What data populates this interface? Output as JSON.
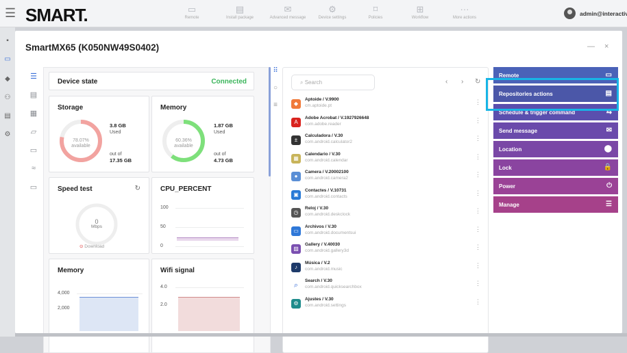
{
  "header": {
    "logo": "SMART.",
    "nav": [
      {
        "label": "Remote",
        "icon": "monitor-icon"
      },
      {
        "label": "Install package",
        "icon": "package-icon"
      },
      {
        "label": "Advanced message",
        "icon": "message-icon"
      },
      {
        "label": "Device settings",
        "icon": "gear-icon"
      },
      {
        "label": "Policies",
        "icon": "bookmark-icon"
      },
      {
        "label": "Workflow",
        "icon": "workflow-icon"
      },
      {
        "label": "More actions",
        "icon": "more-icon"
      }
    ],
    "user": "admin@interactiv"
  },
  "modal": {
    "title": "SmartMX65 (K050NW49S0402)",
    "device_state": {
      "label": "Device state",
      "status": "Connected"
    },
    "storage": {
      "title": "Storage",
      "used": "3.8 GB",
      "used_label": "Used",
      "available_pct": "78.07%",
      "available_label": "available",
      "out_of_label": "out of",
      "total": "17.35 GB",
      "available_fraction": 0.7807
    },
    "memory": {
      "title": "Memory",
      "used": "1.87 GB",
      "used_label": "Used",
      "available_pct": "60.36%",
      "available_label": "available",
      "out_of_label": "out of",
      "total": "4.73 GB",
      "available_fraction": 0.6036
    },
    "speed_test": {
      "title": "Speed test",
      "value": "0",
      "unit": "Mbps",
      "download": "Download"
    },
    "cpu": {
      "title": "CPU_PERCENT",
      "ticks": [
        "100",
        "50",
        "0"
      ]
    },
    "memory_chart": {
      "title": "Memory",
      "ticks": [
        "4,000",
        "2,000"
      ]
    },
    "wifi": {
      "title": "Wifi signal",
      "ticks": [
        "4.0",
        "2.0"
      ]
    },
    "apps": {
      "search_placeholder": "Search",
      "items": [
        {
          "name": "Aptoide / V.9900",
          "pkg": "cm.aptoide.pt",
          "color": "#f07a3a",
          "glyph": "◆"
        },
        {
          "name": "Adobe Acrobat / V.1927926648",
          "pkg": "com.adobe.reader",
          "color": "#d9231e",
          "glyph": "A"
        },
        {
          "name": "Calculadora / V.30",
          "pkg": "com.android.calculator2",
          "color": "#333333",
          "glyph": "±"
        },
        {
          "name": "Calendario / V.30",
          "pkg": "com.android.calendar",
          "color": "#c8b45a",
          "glyph": "▦"
        },
        {
          "name": "Camera / V.20002100",
          "pkg": "com.android.camera2",
          "color": "#5a8fd6",
          "glyph": "●"
        },
        {
          "name": "Contactes / V.10731",
          "pkg": "com.android.contacts",
          "color": "#2a7ad6",
          "glyph": "▣"
        },
        {
          "name": "Reloj / V.30",
          "pkg": "com.android.deskclock",
          "color": "#555555",
          "glyph": "◷"
        },
        {
          "name": "Archivos / V.30",
          "pkg": "com.android.documentsui",
          "color": "#2f78d8",
          "glyph": "▭"
        },
        {
          "name": "Gallery / V.40030",
          "pkg": "com.android.gallery3d",
          "color": "#7a4fb0",
          "glyph": "▨"
        },
        {
          "name": "Música / V.2",
          "pkg": "com.android.music",
          "color": "#1e3a6a",
          "glyph": "♪"
        },
        {
          "name": "Search / V.30",
          "pkg": "com.android.quicksearchbox",
          "color": "#ffffff",
          "glyph": "⌕"
        },
        {
          "name": "Ajustes / V.30",
          "pkg": "com.android.settings",
          "color": "#1f8c8c",
          "glyph": "⚙"
        }
      ]
    },
    "actions": [
      {
        "label": "Remote",
        "color": "#4a62b8",
        "icon": "monitor-icon",
        "glyph": "▭"
      },
      {
        "label": "Repositories actions",
        "color": "#4b57a8",
        "icon": "clipboard-icon",
        "glyph": "▤"
      },
      {
        "label": "Schedule & trigger command",
        "color": "#5a4fae",
        "icon": "command-icon",
        "glyph": "⇆"
      },
      {
        "label": "Send message",
        "color": "#6a4aab",
        "icon": "mail-icon",
        "glyph": "✉"
      },
      {
        "label": "Location",
        "color": "#7a47a6",
        "icon": "pin-icon",
        "glyph": "⬤"
      },
      {
        "label": "Lock",
        "color": "#8a44a0",
        "icon": "lock-icon",
        "glyph": "🔒"
      },
      {
        "label": "Power",
        "color": "#9a4296",
        "icon": "power-icon",
        "glyph": "⏻"
      },
      {
        "label": "Manage",
        "color": "#a6418a",
        "icon": "list-icon",
        "glyph": "☰"
      }
    ]
  }
}
